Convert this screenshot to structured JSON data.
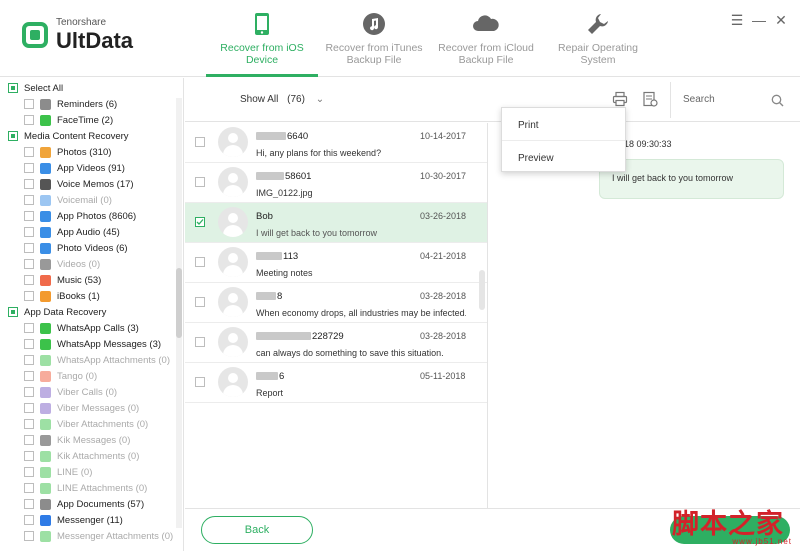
{
  "app": {
    "company": "Tenorshare",
    "product": "UltData"
  },
  "nav": [
    {
      "label": "Recover from iOS Device",
      "icon": "phone-icon",
      "active": true
    },
    {
      "label": "Recover from iTunes Backup File",
      "icon": "music-note-icon",
      "active": false
    },
    {
      "label": "Recover from iCloud Backup File",
      "icon": "cloud-icon",
      "active": false
    },
    {
      "label": "Repair Operating System",
      "icon": "wrench-icon",
      "active": false
    }
  ],
  "window_controls": {
    "menu": "☰",
    "minimize": "—",
    "close": "✕"
  },
  "sidebar": {
    "select_all": "Select All",
    "items": [
      {
        "label": "Reminders (6)",
        "kind": "item",
        "icon": "reminders-icon",
        "color": "#8c8c8c",
        "disabled": false
      },
      {
        "label": "FaceTime (2)",
        "kind": "item",
        "icon": "facetime-icon",
        "color": "#3cc24a",
        "disabled": false
      },
      {
        "label": "Media Content Recovery",
        "kind": "cat"
      },
      {
        "label": "Photos (310)",
        "kind": "item",
        "icon": "photos-icon",
        "color": "#f0a43a",
        "disabled": false
      },
      {
        "label": "App Videos (91)",
        "kind": "item",
        "icon": "app-videos-icon",
        "color": "#3a8ee6",
        "disabled": false
      },
      {
        "label": "Voice Memos (17)",
        "kind": "item",
        "icon": "voice-memos-icon",
        "color": "#555555",
        "disabled": false
      },
      {
        "label": "Voicemail (0)",
        "kind": "item",
        "icon": "voicemail-icon",
        "color": "#3a8ee6",
        "disabled": true
      },
      {
        "label": "App Photos (8606)",
        "kind": "item",
        "icon": "app-photos-icon",
        "color": "#3a8ee6",
        "disabled": false
      },
      {
        "label": "App Audio (45)",
        "kind": "item",
        "icon": "app-audio-icon",
        "color": "#3a8ee6",
        "disabled": false
      },
      {
        "label": "Photo Videos (6)",
        "kind": "item",
        "icon": "photo-videos-icon",
        "color": "#3a8ee6",
        "disabled": false
      },
      {
        "label": "Videos (0)",
        "kind": "item",
        "icon": "videos-icon",
        "color": "#333333",
        "disabled": true
      },
      {
        "label": "Music (53)",
        "kind": "item",
        "icon": "music-icon",
        "color": "#f06a4a",
        "disabled": false
      },
      {
        "label": "iBooks (1)",
        "kind": "item",
        "icon": "ibooks-icon",
        "color": "#f39a2e",
        "disabled": false
      },
      {
        "label": "App Data Recovery",
        "kind": "cat"
      },
      {
        "label": "WhatsApp Calls (3)",
        "kind": "item",
        "icon": "whatsapp-calls-icon",
        "color": "#3cc24a",
        "disabled": false
      },
      {
        "label": "WhatsApp Messages (3)",
        "kind": "item",
        "icon": "whatsapp-messages-icon",
        "color": "#3cc24a",
        "disabled": false
      },
      {
        "label": "WhatsApp Attachments (0)",
        "kind": "item",
        "icon": "whatsapp-attachments-icon",
        "color": "#3cc24a",
        "disabled": true
      },
      {
        "label": "Tango (0)",
        "kind": "item",
        "icon": "tango-icon",
        "color": "#f05a3a",
        "disabled": true
      },
      {
        "label": "Viber Calls (0)",
        "kind": "item",
        "icon": "viber-calls-icon",
        "color": "#7b5ec6",
        "disabled": true
      },
      {
        "label": "Viber Messages (0)",
        "kind": "item",
        "icon": "viber-messages-icon",
        "color": "#7b5ec6",
        "disabled": true
      },
      {
        "label": "Viber Attachments (0)",
        "kind": "item",
        "icon": "viber-attachments-icon",
        "color": "#3cc24a",
        "disabled": true
      },
      {
        "label": "Kik Messages (0)",
        "kind": "item",
        "icon": "kik-messages-icon",
        "color": "#333333",
        "disabled": true
      },
      {
        "label": "Kik Attachments (0)",
        "kind": "item",
        "icon": "kik-attachments-icon",
        "color": "#3cc24a",
        "disabled": true
      },
      {
        "label": "LINE (0)",
        "kind": "item",
        "icon": "line-icon",
        "color": "#3cc24a",
        "disabled": true
      },
      {
        "label": "LINE Attachments (0)",
        "kind": "item",
        "icon": "line-attachments-icon",
        "color": "#3cc24a",
        "disabled": true
      },
      {
        "label": "App Documents (57)",
        "kind": "item",
        "icon": "app-documents-icon",
        "color": "#8c8c8c",
        "disabled": false
      },
      {
        "label": "Messenger (11)",
        "kind": "item",
        "icon": "messenger-icon",
        "color": "#2f7be6",
        "disabled": false
      },
      {
        "label": "Messenger Attachments (0)",
        "kind": "item",
        "icon": "messenger-attachments-icon",
        "color": "#3cc24a",
        "disabled": true
      }
    ]
  },
  "toolbar": {
    "show_all": "Show All",
    "count": "(76)",
    "search_placeholder": "Search"
  },
  "messages": [
    {
      "contact_suffix": "6640",
      "date": "10-14-2017",
      "preview": "Hi, any plans for this weekend?",
      "selected": false,
      "blur": [
        30
      ]
    },
    {
      "contact_suffix": "58601",
      "date": "10-30-2017",
      "preview": "IMG_0122.jpg",
      "selected": false,
      "blur": [
        28
      ]
    },
    {
      "contact_suffix": "Bob",
      "date": "03-26-2018",
      "preview": "I will get back to you tomorrow",
      "selected": true,
      "blur": []
    },
    {
      "contact_suffix": "113",
      "date": "04-21-2018",
      "preview": "Meeting notes",
      "selected": false,
      "blur": [
        26
      ]
    },
    {
      "contact_suffix": "8",
      "date": "03-28-2018",
      "preview": "When economy drops, all industries may be infected. .",
      "selected": false,
      "blur": [
        20
      ]
    },
    {
      "contact_suffix": "228729",
      "date": "03-28-2018",
      "preview": "can always do something to save this situation.",
      "selected": false,
      "blur": [
        55
      ]
    },
    {
      "contact_suffix": "6",
      "date": "05-11-2018",
      "preview": "Report",
      "selected": false,
      "blur": [
        22
      ]
    }
  ],
  "detail": {
    "time": "-2018 09:30:33",
    "bubble": "I will get back to you tomorrow"
  },
  "popup": {
    "print": "Print",
    "preview": "Preview"
  },
  "footer": {
    "back": "Back"
  },
  "watermark": {
    "main": "脚本之家",
    "sub": "www.jb51.net"
  },
  "colors": {
    "accent": "#2eaf62",
    "selected_row": "#dff2e4",
    "watermark": "#d2232a"
  }
}
